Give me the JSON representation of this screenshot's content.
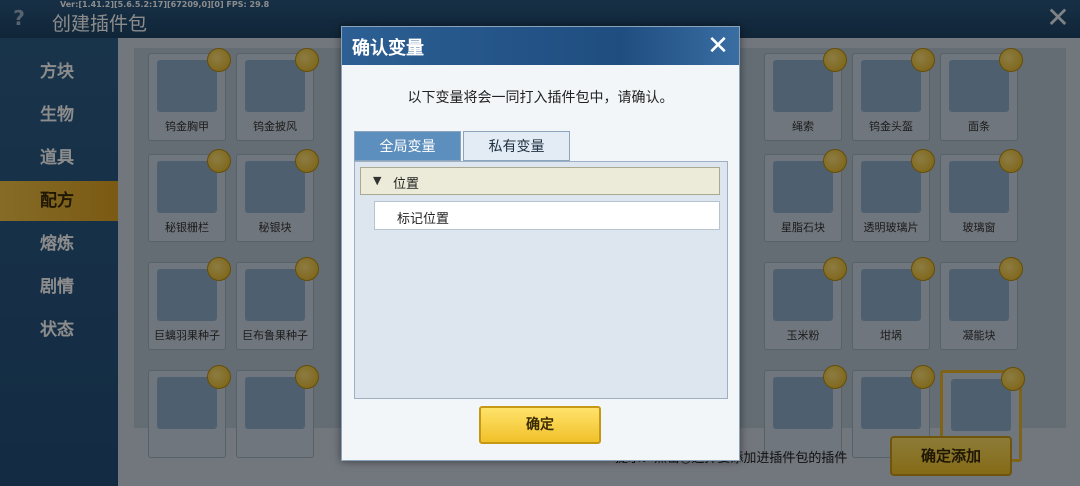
{
  "topbar": {
    "version": "Ver:[1.41.2][5.6.5.2:17][67209,0][0] FPS: 29.8",
    "title": "创建插件包"
  },
  "sidebar": {
    "items": [
      "方块",
      "生物",
      "道具",
      "配方",
      "熔炼",
      "剧情",
      "状态"
    ]
  },
  "items": [
    {
      "label": "钨金胸甲"
    },
    {
      "label": "钨金披风"
    },
    {
      "label": "绳索"
    },
    {
      "label": "钨金头盔"
    },
    {
      "label": "面条"
    },
    {
      "label": "秘银栅栏"
    },
    {
      "label": "秘银块"
    },
    {
      "label": "星脂石块"
    },
    {
      "label": "透明玻璃片"
    },
    {
      "label": "玻璃窗"
    },
    {
      "label": "巨螭羽果种子"
    },
    {
      "label": "巨布鲁果种子"
    },
    {
      "label": "玉米粉"
    },
    {
      "label": "坩埚"
    },
    {
      "label": "凝能块"
    },
    {
      "label": ""
    },
    {
      "label": ""
    },
    {
      "label": ""
    },
    {
      "label": ""
    },
    {
      "label": ""
    }
  ],
  "footer": {
    "hint": "提示：点击○选择要添加进插件包的插件",
    "add_label": "确定添加"
  },
  "dialog": {
    "title": "确认变量",
    "message": "以下变量将会一同打入插件包中，请确认。",
    "tabs": [
      "全局变量",
      "私有变量"
    ],
    "group": "位置",
    "item": "标记位置",
    "confirm": "确定"
  }
}
